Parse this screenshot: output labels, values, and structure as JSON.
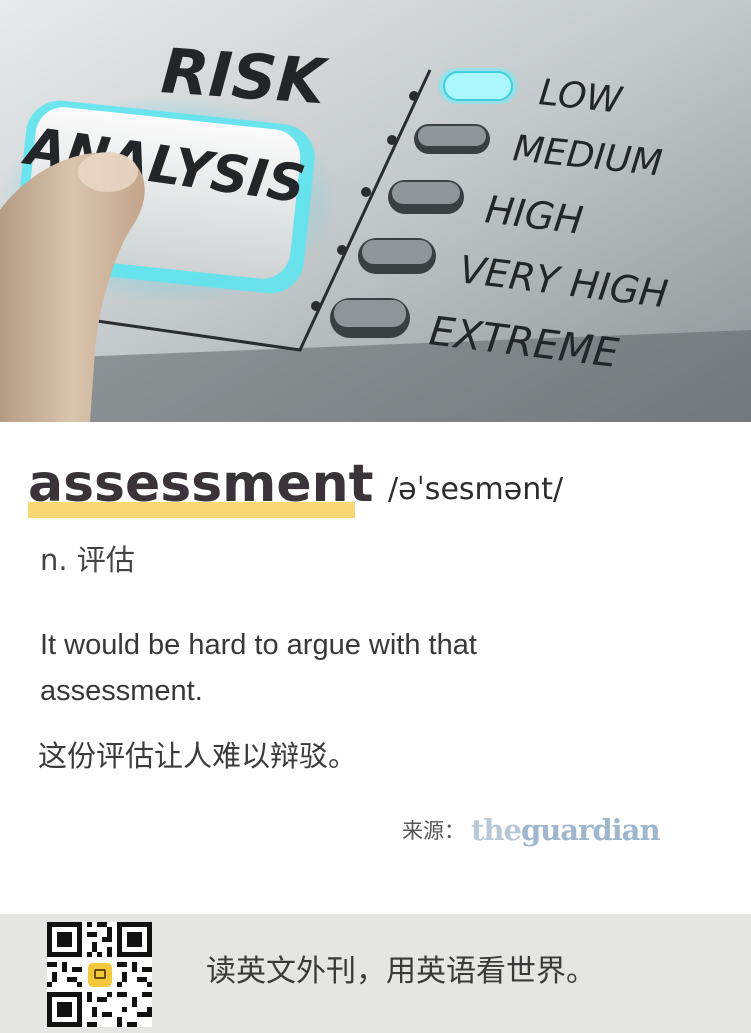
{
  "hero": {
    "panel_title": "RISK",
    "button_label": "ANALYSIS",
    "levels": [
      {
        "label": "LOW",
        "active": true
      },
      {
        "label": "MEDIUM",
        "active": false
      },
      {
        "label": "HIGH",
        "active": false
      },
      {
        "label": "VERY HIGH",
        "active": false
      },
      {
        "label": "EXTREME",
        "active": false
      }
    ]
  },
  "word": {
    "headword": "assessment",
    "phonetic": "/əˈsesmənt/",
    "part_of_speech": "n. 评估"
  },
  "example": {
    "english": "It would be hard to argue with that assessment.",
    "chinese": "这份评估让人难以辩驳。"
  },
  "source": {
    "label": "来源：",
    "logo_prefix": "the",
    "logo_main": "guardian"
  },
  "footer": {
    "slogan": "读英文外刊，用英语看世界。"
  },
  "colors": {
    "highlight": "#f8d774",
    "guardian_blue": "#9fb7cc",
    "footer_bg": "#e5e5e3",
    "glow": "#49e0ee"
  }
}
